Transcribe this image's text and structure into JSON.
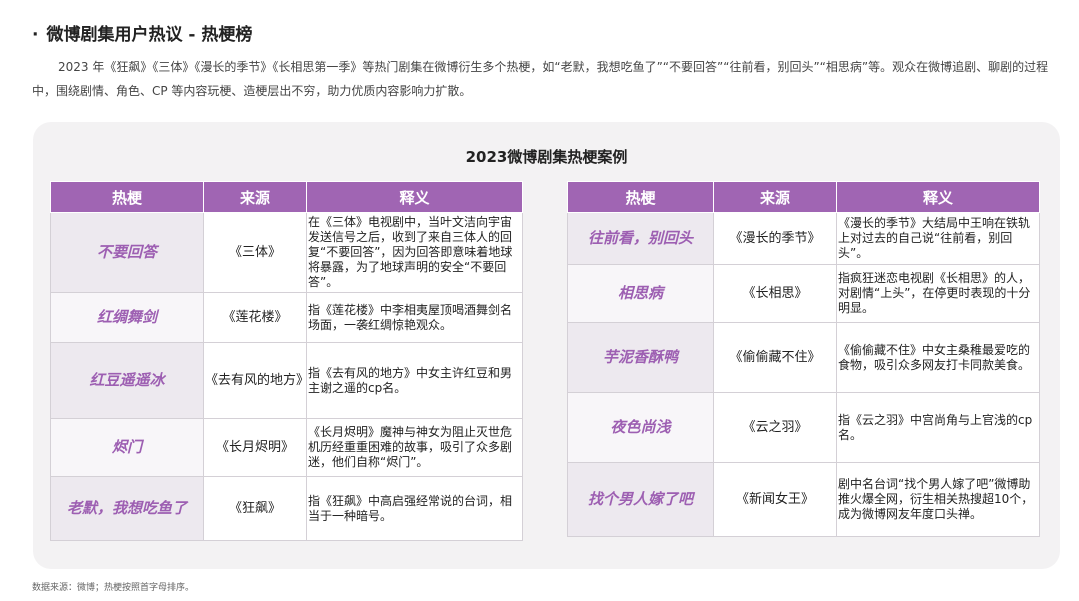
{
  "section": {
    "bullet": "·",
    "title": "微博剧集用户热议 - 热梗榜"
  },
  "intro": "2023 年《狂飙》《三体》《漫长的季节》《长相思第一季》等热门剧集在微博衍生多个热梗，如“老默，我想吃鱼了”“不要回答”“往前看，别回头”“相思病”等。观众在微博追剧、聊剧的过程中，围绕剧情、角色、CP 等内容玩梗、造梗层出不穷，助力优质内容影响力扩散。",
  "panel": {
    "title": "2023微博剧集热梗案例"
  },
  "headers": {
    "meme": "热梗",
    "source": "来源",
    "explanation": "释义"
  },
  "left_rows": [
    {
      "meme": "不要回答",
      "source": "《三体》",
      "explanation": "在《三体》电视剧中，当叶文洁向宇宙发送信号之后，收到了来自三体人的回复“不要回答”，因为回答即意味着地球将暴露，为了地球声明的安全“不要回答”。"
    },
    {
      "meme": "红绸舞剑",
      "source": "《莲花楼》",
      "explanation": "指《莲花楼》中李相夷屋顶喝酒舞剑名场面，一袭红绸惊艳观众。"
    },
    {
      "meme": "红豆遥遥冰",
      "source": "《去有风的地方》",
      "explanation": "指《去有风的地方》中女主许红豆和男主谢之遥的cp名。"
    },
    {
      "meme": "烬门",
      "source": "《长月烬明》",
      "explanation": "《长月烬明》魔神与神女为阻止灭世危机历经重重困难的故事，吸引了众多剧迷，他们自称“烬门”。"
    },
    {
      "meme": "老默，我想吃鱼了",
      "source": "《狂飙》",
      "explanation": "指《狂飙》中高启强经常说的台词，相当于一种暗号。"
    }
  ],
  "right_rows": [
    {
      "meme": "往前看，别回头",
      "source": "《漫长的季节》",
      "explanation": "《漫长的季节》大结局中王响在铁轨上对过去的自己说“往前看，别回头”。"
    },
    {
      "meme": "相思病",
      "source": "《长相思》",
      "explanation": "指疯狂迷恋电视剧《长相思》的人，对剧情“上头”，在停更时表现的十分明显。"
    },
    {
      "meme": "芋泥香酥鸭",
      "source": "《偷偷藏不住》",
      "explanation": "《偷偷藏不住》中女主桑稚最爱吃的食物，吸引众多网友打卡同款美食。"
    },
    {
      "meme": "夜色尚浅",
      "source": "《云之羽》",
      "explanation": "指《云之羽》中宫尚角与上官浅的cp名。"
    },
    {
      "meme": "找个男人嫁了吧",
      "source": "《新闻女王》",
      "explanation": "剧中名台词“找个男人嫁了吧”微博助推火爆全网，衍生相关热搜超10个，成为微博网友年度口头禅。"
    }
  ],
  "footnote": "数据来源：微博；热梗按照首字母排序。"
}
